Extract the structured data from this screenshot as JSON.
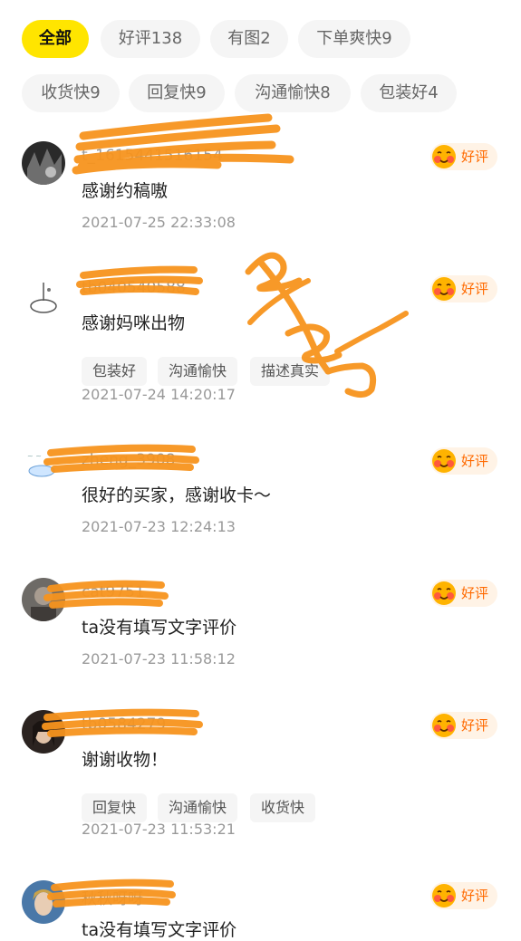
{
  "filters": [
    {
      "label": "全部",
      "active": true
    },
    {
      "label": "好评138",
      "active": false
    },
    {
      "label": "有图2",
      "active": false
    },
    {
      "label": "下单爽快9",
      "active": false
    },
    {
      "label": "收货快9",
      "active": false
    },
    {
      "label": "回复快9",
      "active": false
    },
    {
      "label": "沟通愉快8",
      "active": false
    },
    {
      "label": "包装好4",
      "active": false
    }
  ],
  "reviews": [
    {
      "username": "t_1615441516154",
      "badge": "好评",
      "content": "感谢约稿嗷",
      "tags": [],
      "time": "2021-07-25 22:33:08"
    },
    {
      "username": "tb040540588",
      "badge": "好评",
      "content": "感谢妈咪出物",
      "tags": [
        "包装好",
        "沟通愉快",
        "描述真实"
      ],
      "time": "2021-07-24 14:20:17"
    },
    {
      "username": "zheng_3908",
      "badge": "好评",
      "content": "很好的买家，感谢收卡～",
      "tags": [],
      "time": "2021-07-23 12:24:13"
    },
    {
      "username": "cat9751",
      "badge": "好评",
      "content": "ta没有填写文字评价",
      "tags": [],
      "time": "2021-07-23 11:58:12"
    },
    {
      "username": "tb0584279",
      "badge": "好评",
      "content": "谢谢收物！",
      "tags": [
        "回复快",
        "沟通愉快",
        "收货快"
      ],
      "time": "2021-07-23 11:53:21"
    },
    {
      "username": "秋秋呀呀",
      "badge": "好评",
      "content": "ta没有填写文字评价",
      "tags": [],
      "time": ""
    }
  ],
  "annotation": "2/25",
  "colors": {
    "accent": "#ffe500",
    "badge_text": "#ff6a00",
    "scribble": "#f7941d"
  }
}
